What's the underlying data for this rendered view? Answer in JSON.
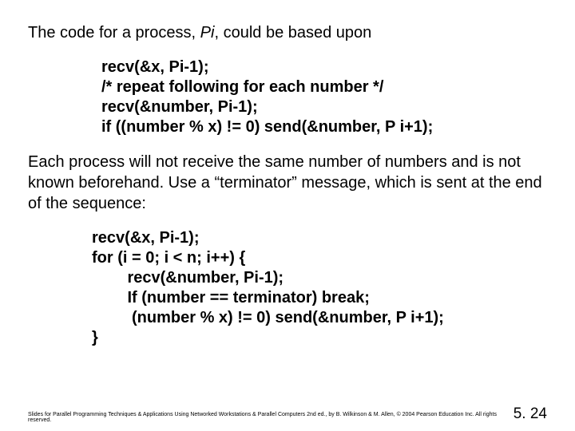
{
  "intro_prefix": "The code for a process, ",
  "intro_pi": "Pi",
  "intro_suffix": ", could be based upon",
  "code1": {
    "l1": "recv(&x, Pi-1);",
    "l2": "/* repeat following for each number */",
    "l3": "recv(&number, Pi-1);",
    "l4": "if ((number % x) != 0) send(&number, P i+1);"
  },
  "para": "Each process will not receive the same number of numbers and is not known beforehand. Use a “terminator” message, which is sent at the end of the sequence:",
  "code2": {
    "l1": "recv(&x, Pi-1);",
    "l2": "for (i = 0; i < n; i++) {",
    "l3": "        recv(&number, Pi-1);",
    "l4": "        If (number == terminator) break;",
    "l5": "         (number % x) != 0) send(&number, P i+1);",
    "l6": "}"
  },
  "footer_credit": "Slides for Parallel Programming Techniques & Applications Using Networked Workstations & Parallel Computers 2nd ed., by B. Wilkinson & M. Allen, © 2004 Pearson Education Inc. All rights reserved.",
  "page_number": "5. 24"
}
